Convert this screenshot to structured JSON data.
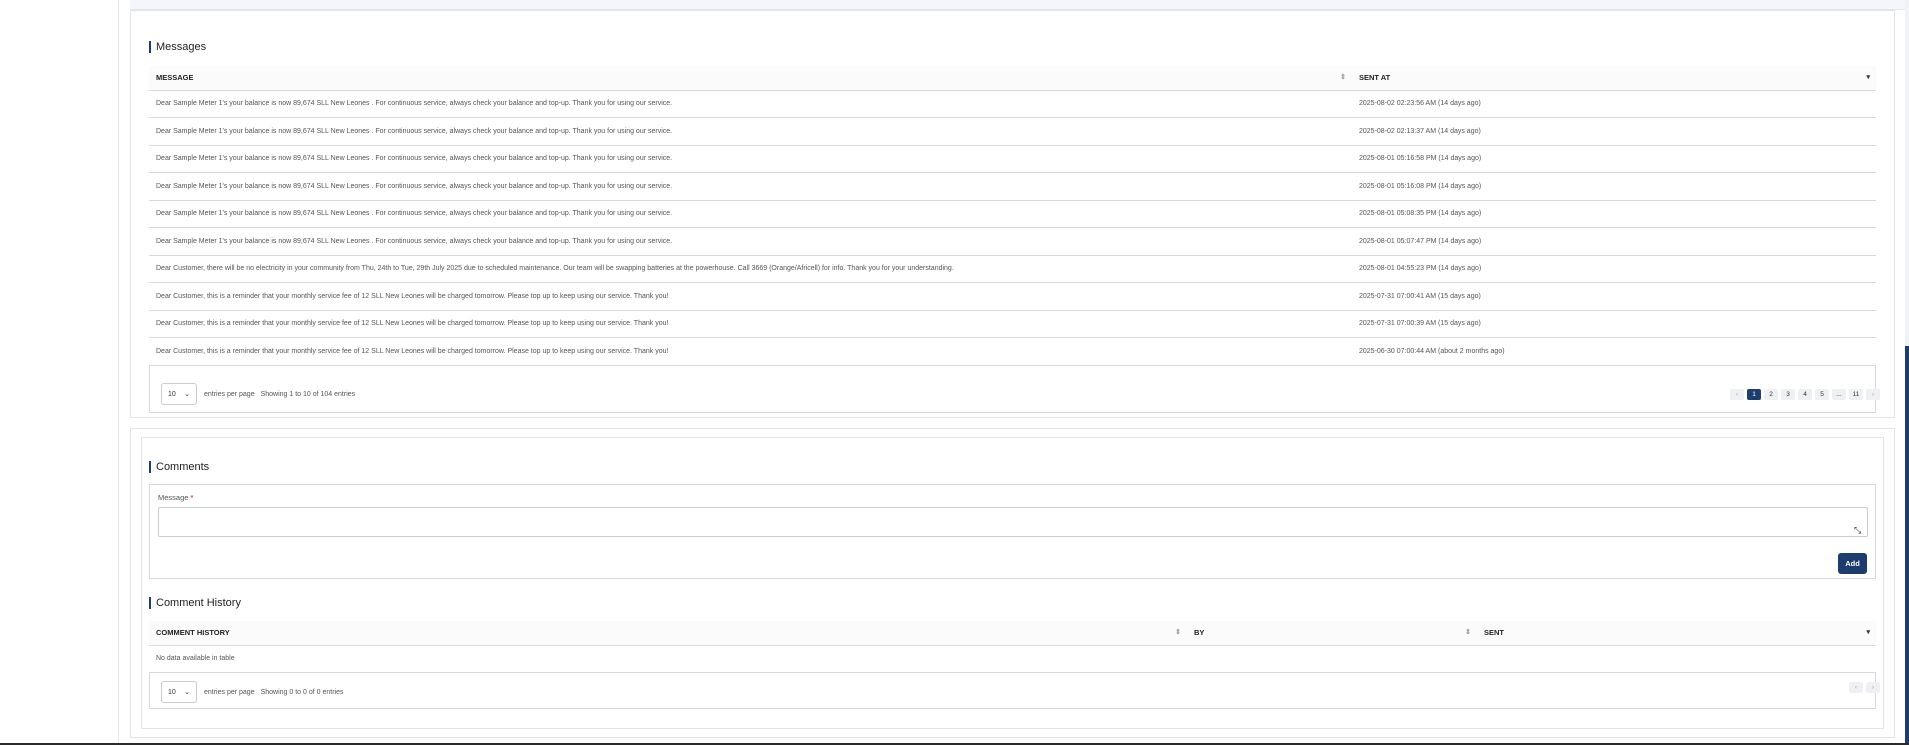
{
  "messages": {
    "title": "Messages",
    "columns": {
      "message": "MESSAGE",
      "sent_at": "SENT AT"
    },
    "rows": [
      {
        "message": "Dear Sample Meter 1's your balance is now 89,674 SLL New Leones . For continuous service, always check your balance and top-up. Thank you for using our service.",
        "sent_at": "2025-08-02 02:23:56 AM (14 days ago)"
      },
      {
        "message": "Dear Sample Meter 1's your balance is now 89,674 SLL New Leones . For continuous service, always check your balance and top-up. Thank you for using our service.",
        "sent_at": "2025-08-02 02:13:37 AM (14 days ago)"
      },
      {
        "message": "Dear Sample Meter 1's your balance is now 89,674 SLL New Leones . For continuous service, always check your balance and top-up. Thank you for using our service.",
        "sent_at": "2025-08-01 05:16:58 PM (14 days ago)"
      },
      {
        "message": "Dear Sample Meter 1's your balance is now 89,674 SLL New Leones . For continuous service, always check your balance and top-up. Thank you for using our service.",
        "sent_at": "2025-08-01 05:16:08 PM (14 days ago)"
      },
      {
        "message": "Dear Sample Meter 1's your balance is now 89,674 SLL New Leones . For continuous service, always check your balance and top-up. Thank you for using our service.",
        "sent_at": "2025-08-01 05:08:35 PM (14 days ago)"
      },
      {
        "message": "Dear Sample Meter 1's your balance is now 89,674 SLL New Leones . For continuous service, always check your balance and top-up. Thank you for using our service.",
        "sent_at": "2025-08-01 05:07:47 PM (14 days ago)"
      },
      {
        "message": "Dear Customer, there will be no electricity in your community from Thu, 24th to Tue, 29th July 2025 due to scheduled maintenance. Our team will be swapping batteries at the powerhouse. Call 3669 (Orange/Africell) for info. Thank you for your understanding.",
        "sent_at": "2025-08-01 04:55:23 PM (14 days ago)"
      },
      {
        "message": "Dear Customer, this is a reminder that your monthly service fee of 12 SLL New Leones will be charged tomorrow. Please top up to keep using our service. Thank you!",
        "sent_at": "2025-07-31 07:00:41 AM (15 days ago)"
      },
      {
        "message": "Dear Customer, this is a reminder that your monthly service fee of 12 SLL New Leones will be charged tomorrow. Please top up to keep using our service. Thank you!",
        "sent_at": "2025-07-31 07:00:39 AM (15 days ago)"
      },
      {
        "message": "Dear Customer, this is a reminder that your monthly service fee of 12 SLL New Leones will be charged tomorrow. Please top up to keep using our service. Thank you!",
        "sent_at": "2025-06-30 07:00:44 AM (about 2 months ago)"
      }
    ],
    "per_page": "10",
    "per_page_label": "entries per page",
    "info": "Showing 1 to 10 of 104 entries",
    "pages": [
      "‹",
      "1",
      "2",
      "3",
      "4",
      "5",
      "...",
      "11",
      "›"
    ],
    "active_page": "1"
  },
  "comments": {
    "title": "Comments",
    "message_label": "Message",
    "required_mark": "*",
    "message_value": "",
    "add_label": "Add",
    "history_title": "Comment History",
    "columns": {
      "comment_history": "COMMENT HISTORY",
      "by": "BY",
      "sent": "SENT"
    },
    "empty_text": "No data available in table",
    "per_page": "10",
    "per_page_label": "entries per page",
    "info": "Showing 0 to 0 of 0 entries",
    "pages": [
      "‹",
      "›"
    ]
  },
  "icons": {
    "sort": "sort-icon",
    "sort_desc": "sort-desc-icon",
    "chevron": "chevron-down-icon",
    "resize": "resize-handle-icon"
  },
  "colors": {
    "accent": "#1d3d6f"
  }
}
